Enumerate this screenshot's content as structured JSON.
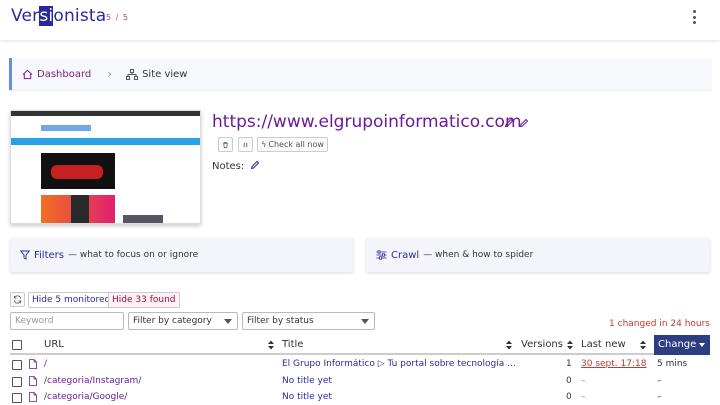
{
  "app": {
    "logo_pre": "Ver",
    "logo_hl": "si",
    "logo_post": "onista",
    "counter": "5 / 5"
  },
  "breadcrumb": {
    "home": "Dashboard",
    "current": "Site view"
  },
  "site": {
    "url": "https://www.elgrupoinformatico.com",
    "check_all": "Check all now",
    "notes_label": "Notes:"
  },
  "panels": {
    "filters_title": "Filters",
    "filters_desc": "— what to focus on or ignore",
    "crawl_title": "Crawl",
    "crawl_desc": "— when & how to spider"
  },
  "controls": {
    "hide_monitored": "Hide 5 monitored",
    "hide_found": "Hide 33 found",
    "keyword_placeholder": "Keyword",
    "category_select": "Filter by category",
    "status_select": "Filter by status",
    "changed_note": "1 changed in 24 hours"
  },
  "table": {
    "headers": {
      "url": "URL",
      "title": "Title",
      "versions": "Versions",
      "last_new": "Last new",
      "change": "Change"
    },
    "rows": [
      {
        "url": "/",
        "title": "El Grupo Informático ▷ Tu portal sobre tecnología e info...",
        "versions": "1",
        "last_new": "30 sept. 17:18",
        "change": "5 mins"
      },
      {
        "url": "/categoria/Instagram/",
        "title": "No title yet",
        "versions": "0",
        "last_new": "–",
        "change": "–"
      },
      {
        "url": "/categoria/Google/",
        "title": "No title yet",
        "versions": "0",
        "last_new": "–",
        "change": "–"
      }
    ]
  },
  "colors": {
    "brand": "#2a2aa0",
    "link": "#6a1b9a",
    "alert": "#c0392b",
    "active_header": "#2c3e80"
  }
}
